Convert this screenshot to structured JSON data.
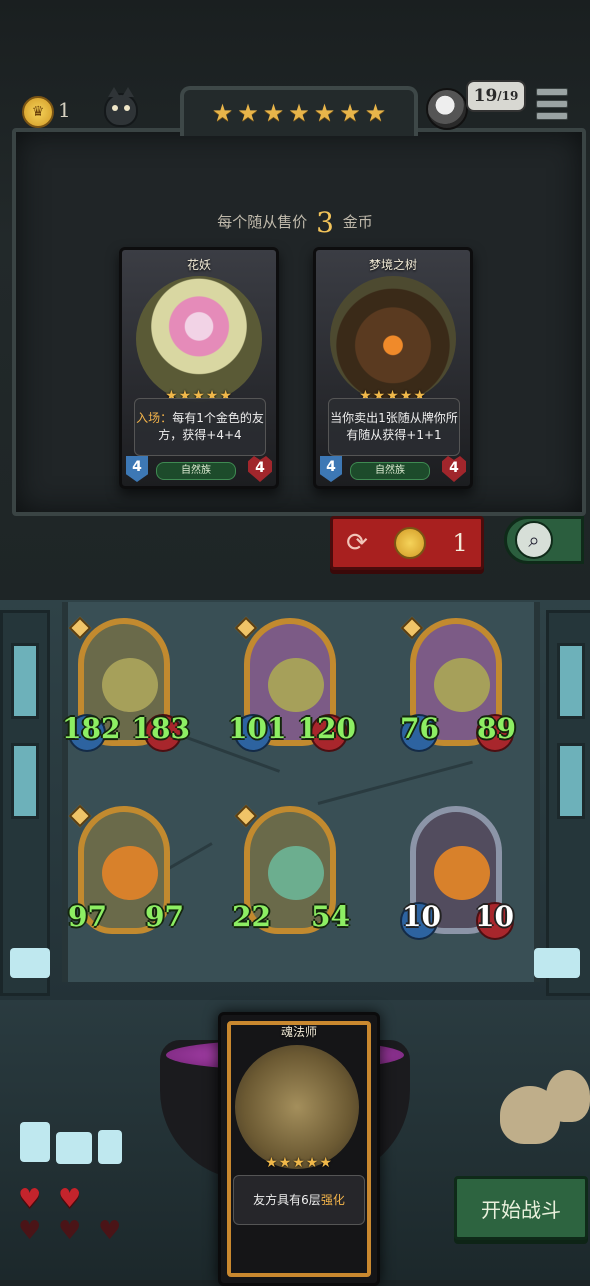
{
  "header": {
    "gold": "1",
    "tavern_stars": [
      "★",
      "★",
      "★",
      "★",
      "★",
      "★",
      "★"
    ],
    "health": "19",
    "health_max": "/19"
  },
  "shop": {
    "sell_prefix": "每个随从售价",
    "sell_price": "3",
    "sell_suffix": "金币",
    "cards": [
      {
        "name": "花妖",
        "stars": "★★★★★",
        "desc_highlight": "入场：",
        "desc": "每有1个金色的友方，获得+4+4",
        "attack": "4",
        "health": "4",
        "tribe": "自然族"
      },
      {
        "name": "梦境之树",
        "stars": "★★★★★",
        "desc_highlight": "",
        "desc": "当你卖出1张随从牌你所有随从获得+1+1",
        "attack": "4",
        "health": "4",
        "tribe": "自然族"
      }
    ],
    "refresh_cost": "1"
  },
  "board": {
    "minions": [
      {
        "attack": "182",
        "health": "183",
        "type": "witch"
      },
      {
        "attack": "101",
        "health": "120",
        "type": "witch"
      },
      {
        "attack": "76",
        "health": "89",
        "type": "witch"
      },
      {
        "attack": "97",
        "health": "97",
        "type": "pumpkin"
      },
      {
        "attack": "22",
        "health": "54",
        "type": "elf"
      },
      {
        "attack": "10",
        "health": "10",
        "type": "pumpkin"
      }
    ]
  },
  "hand": {
    "name": "魂法师",
    "stars": "★★★★★",
    "desc": "友方具有6层",
    "desc_highlight": "强化"
  },
  "lives": {
    "full": 2,
    "total": 5
  },
  "start_button": "开始战斗",
  "colors": {
    "stat_green": "#8dee63",
    "gold": "#e8b54a",
    "refresh_red": "#a8201f",
    "start_green": "#2d6440"
  }
}
